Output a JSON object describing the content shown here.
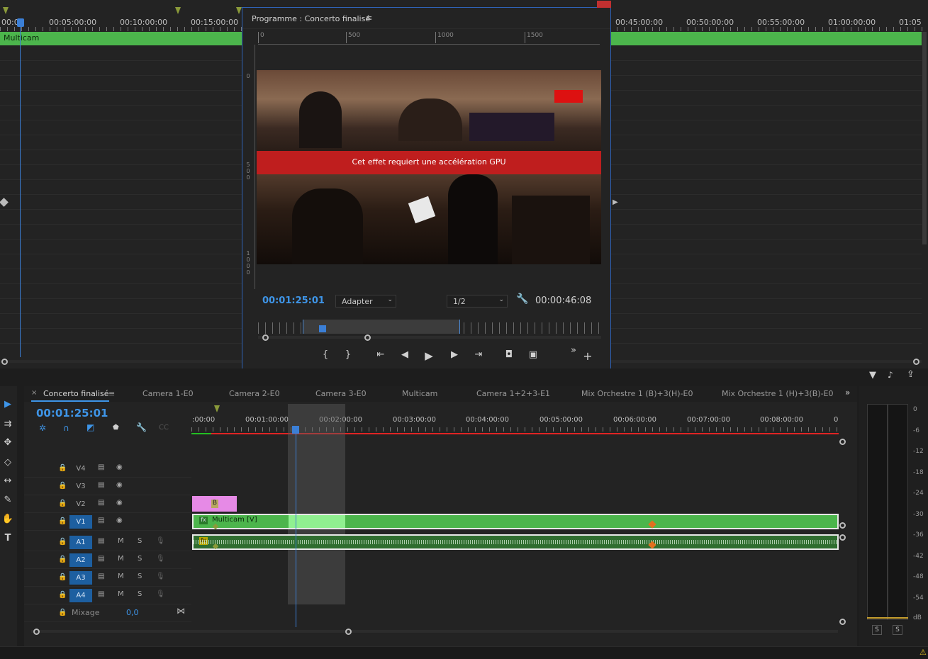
{
  "source_timeline": {
    "timecodes": [
      "00:0",
      "00:05:00:00",
      "00:10:00:00",
      "00:15:00:00",
      "00:45:00:00",
      "00:50:00:00",
      "00:55:00:00",
      "01:00:00:00",
      "01:05"
    ],
    "clip_label": "Multicam"
  },
  "program_monitor": {
    "title": "Programme : Concerto finalisé",
    "menu_icon": "hamburger-icon",
    "ruler_h": [
      "0",
      "500",
      "1000",
      "1500"
    ],
    "ruler_v": [
      "0",
      "5\n0\n0",
      "1\n0\n0\n0"
    ],
    "gpu_message": "Cet effet requiert une accélération GPU",
    "current_timecode": "00:01:25:01",
    "zoom_select": "Adapter",
    "resolution_select": "1/2",
    "duration": "00:00:46:08",
    "controls": {
      "mark_in": "{",
      "mark_out": "}",
      "go_to_in": "⇤",
      "step_back": "◀",
      "play": "▶",
      "step_forward": "▶",
      "go_to_out": "⇥",
      "export_frame": "camera-icon",
      "compare": "compare-icon",
      "more": "»",
      "add": "+"
    }
  },
  "sequence": {
    "tabs": [
      "Concerto finalisé",
      "Camera 1-E0",
      "Camera 2-E0",
      "Camera 3-E0",
      "Multicam",
      "Camera 1+2+3-E1",
      "Mix Orchestre 1 (B)+3(H)-E0",
      "Mix Orchestre 1 (H)+3(B)-E0"
    ],
    "close_glyph": "×",
    "menu_glyph": "≡",
    "overflow_glyph": "»",
    "timecode": "00:01:25:01",
    "ruler": [
      ":00:00",
      "00:01:00:00",
      "00:02:00:00",
      "00:03:00:00",
      "00:04:00:00",
      "00:05:00:00",
      "00:06:00:00",
      "00:07:00:00",
      "00:08:00:00",
      "0"
    ],
    "video_tracks": [
      "V4",
      "V3",
      "V2",
      "V1"
    ],
    "audio_tracks": [
      "A1",
      "A2",
      "A3",
      "A4"
    ],
    "mute_label": "M",
    "solo_label": "S",
    "clip_v1": "Multicam [V]",
    "clip_v2_label": "B",
    "fx_badge": "fx",
    "mix_label": "Mixage",
    "mix_value": "0,0"
  },
  "meter": {
    "db_labels": [
      "0",
      "-6",
      "-12",
      "-18",
      "-24",
      "-30",
      "-36",
      "-42",
      "-48",
      "-54",
      "dB"
    ],
    "solo_buttons": [
      "S",
      "S"
    ]
  },
  "colors": {
    "accent": "#3e95e8",
    "clip_green": "#4cb54c",
    "clip_pink": "#e68ae6",
    "gpu_red": "#bf1e1e",
    "track_blue": "#1d5fa0",
    "marker_orange": "#e07020"
  }
}
